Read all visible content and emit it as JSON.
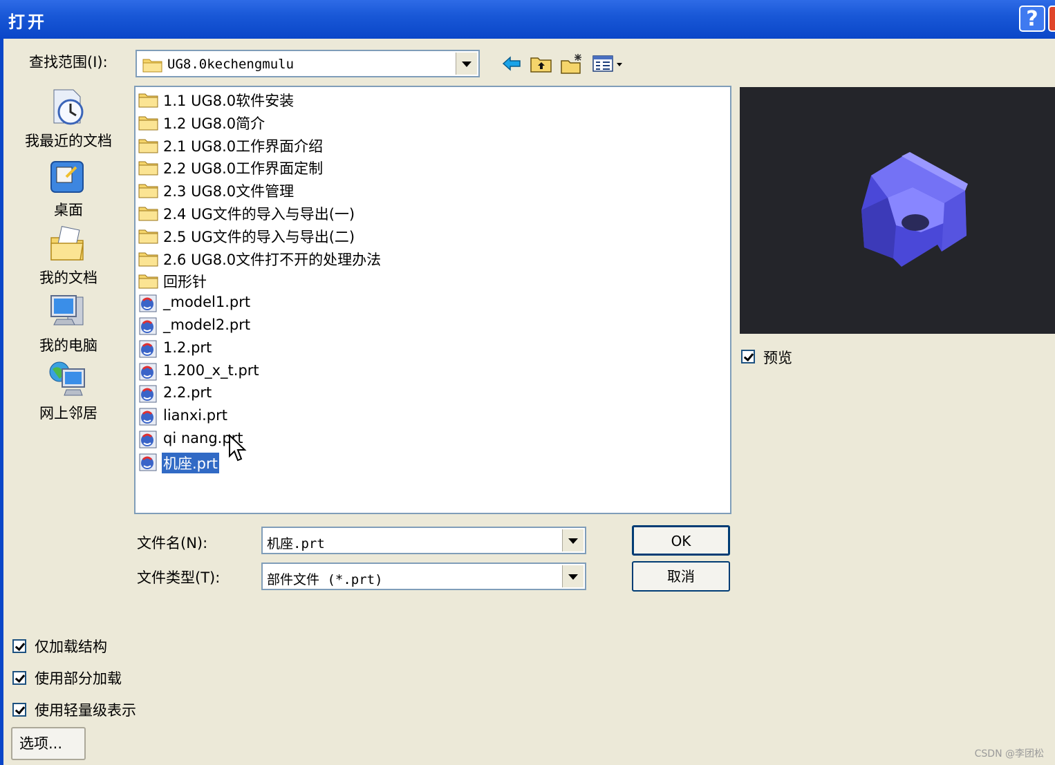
{
  "window": {
    "title": "打开",
    "help_label": "?"
  },
  "look_in": {
    "label": "查找范围(I):",
    "value": "UG8.0kechengmulu"
  },
  "toolbar_icons": [
    "back-icon",
    "up-folder-icon",
    "new-folder-icon",
    "view-menu-icon"
  ],
  "places": [
    {
      "label": "我最近的文档",
      "icon": "recent-documents-icon"
    },
    {
      "label": "桌面",
      "icon": "desktop-icon"
    },
    {
      "label": "我的文档",
      "icon": "my-documents-icon"
    },
    {
      "label": "我的电脑",
      "icon": "my-computer-icon"
    },
    {
      "label": "网上邻居",
      "icon": "network-places-icon"
    }
  ],
  "files": [
    {
      "name": "1.1 UG8.0软件安装",
      "type": "folder"
    },
    {
      "name": "1.2 UG8.0简介",
      "type": "folder"
    },
    {
      "name": "2.1 UG8.0工作界面介绍",
      "type": "folder"
    },
    {
      "name": "2.2 UG8.0工作界面定制",
      "type": "folder"
    },
    {
      "name": "2.3 UG8.0文件管理",
      "type": "folder"
    },
    {
      "name": "2.4 UG文件的导入与导出(一)",
      "type": "folder"
    },
    {
      "name": "2.5 UG文件的导入与导出(二)",
      "type": "folder"
    },
    {
      "name": "2.6 UG8.0文件打不开的处理办法",
      "type": "folder"
    },
    {
      "name": "回形针",
      "type": "folder"
    },
    {
      "name": "_model1.prt",
      "type": "prt"
    },
    {
      "name": "_model2.prt",
      "type": "prt"
    },
    {
      "name": "1.2.prt",
      "type": "prt"
    },
    {
      "name": "1.200_x_t.prt",
      "type": "prt"
    },
    {
      "name": "2.2.prt",
      "type": "prt"
    },
    {
      "name": "lianxi.prt",
      "type": "prt"
    },
    {
      "name": "qi nang.prt",
      "type": "prt"
    },
    {
      "name": "机座.prt",
      "type": "prt",
      "selected": true
    }
  ],
  "preview": {
    "checkbox_label": "预览",
    "checked": true
  },
  "filename": {
    "label": "文件名(N):",
    "value": "机座.prt"
  },
  "filetype": {
    "label": "文件类型(T):",
    "value": "部件文件 (*.prt)"
  },
  "buttons": {
    "ok": "OK",
    "cancel": "取消",
    "options": "选项..."
  },
  "options": [
    {
      "label": "仅加载结构",
      "checked": true
    },
    {
      "label": "使用部分加载",
      "checked": true
    },
    {
      "label": "使用轻量级表示",
      "checked": true
    }
  ],
  "watermark": "CSDN @李团松",
  "colors": {
    "title_bar": "#0a46c8",
    "selection": "#316ac5",
    "dialog_bg": "#ece9d8",
    "preview_bg": "#24252a",
    "model": "#5a5ae6"
  }
}
